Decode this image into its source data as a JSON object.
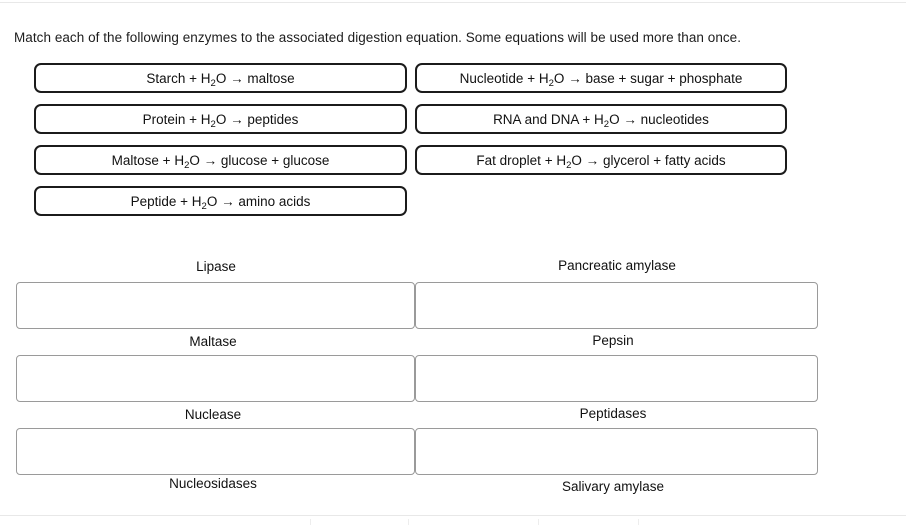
{
  "instructions": {
    "text": "Match each of the following enzymes to the associated digestion equation. Some equations will be used more than once."
  },
  "equation_tiles": {
    "left_column": [
      {
        "id": "starch-maltose",
        "reactant": "Starch",
        "water": "H",
        "water_sub": "2",
        "water_tail": "O",
        "arrow": "→",
        "products": "maltose"
      },
      {
        "id": "protein-peptides",
        "reactant": "Protein",
        "water": "H",
        "water_sub": "2",
        "water_tail": "O",
        "arrow": "→",
        "products": "peptides"
      },
      {
        "id": "maltose-glucose",
        "reactant": "Maltose",
        "water": "H",
        "water_sub": "2",
        "water_tail": "O",
        "arrow": "→",
        "products": "glucose + glucose"
      },
      {
        "id": "peptide-amino",
        "reactant": "Peptide",
        "water": "H",
        "water_sub": "2",
        "water_tail": "O",
        "arrow": "→",
        "products": "amino acids"
      }
    ],
    "right_column": [
      {
        "id": "nucleotide-base",
        "reactant": "Nucleotide",
        "water": "H",
        "water_sub": "2",
        "water_tail": "O",
        "arrow": "→",
        "products": "base + sugar + phosphate"
      },
      {
        "id": "rnadna-nucleotides",
        "reactant": "RNA and DNA",
        "water": "H",
        "water_sub": "2",
        "water_tail": "O",
        "arrow": "→",
        "products": "nucleotides"
      },
      {
        "id": "fat-glycerol",
        "reactant": "Fat droplet",
        "water": "H",
        "water_sub": "2",
        "water_tail": "O",
        "arrow": "→",
        "products": "glycerol + fatty acids"
      }
    ],
    "plus": "+"
  },
  "answer_zones": [
    {
      "id": "lipase",
      "label": "Lipase",
      "label_position": "above",
      "value": ""
    },
    {
      "id": "pancreatic-amylase",
      "label": "Pancreatic amylase",
      "label_position": "above",
      "value": ""
    },
    {
      "id": "maltase",
      "label": "Maltase",
      "label_position": "above",
      "value": ""
    },
    {
      "id": "pepsin",
      "label": "Pepsin",
      "label_position": "above",
      "value": ""
    },
    {
      "id": "nuclease",
      "label": "Nuclease",
      "label_position": "above",
      "value": ""
    },
    {
      "id": "peptidases",
      "label": "Peptidases",
      "label_position": "above",
      "value": ""
    },
    {
      "id": "nucleosidases",
      "label": "Nucleosidases",
      "label_position": "below",
      "value": ""
    },
    {
      "id": "salivary-amylase",
      "label": "Salivary amylase",
      "label_position": "below",
      "value": ""
    }
  ],
  "colors": {
    "tile_border": "#1b1b1b",
    "zone_border": "#9a9a9a",
    "text": "#111111",
    "hairline": "#e8e8e8",
    "background": "#ffffff"
  }
}
